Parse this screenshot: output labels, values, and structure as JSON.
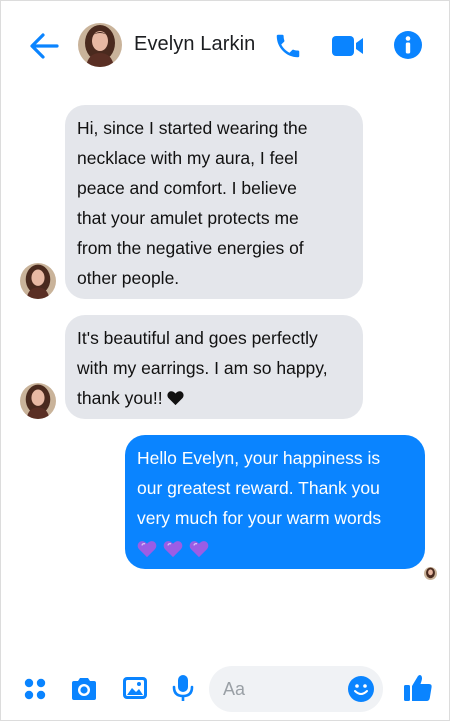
{
  "header": {
    "contact_name": "Evelyn Larkin",
    "icons": {
      "back": "arrow-left-icon",
      "call": "phone-icon",
      "video": "video-camera-icon",
      "info": "info-icon"
    }
  },
  "conversation": {
    "messages": [
      {
        "direction": "incoming",
        "lines": [
          "Hi, since I started wearing the",
          "necklace with my aura, I feel",
          "peace and comfort. I believe",
          "that your amulet protects me",
          "from the negative energies of",
          "other people."
        ]
      },
      {
        "direction": "incoming",
        "lines": [
          "It's beautiful and goes perfectly",
          "with my earrings. I am so happy,",
          "thank you!!"
        ],
        "trailing_emoji": "black-heart-icon"
      },
      {
        "direction": "outgoing",
        "lines": [
          "Hello Evelyn, your happiness is",
          "our greatest reward. Thank you",
          "very much for your warm words"
        ],
        "trailing_emoji": [
          "purple-heart-icon",
          "purple-heart-icon",
          "purple-heart-icon"
        ]
      }
    ]
  },
  "composer": {
    "placeholder": "Aa",
    "icons": [
      "apps-icon",
      "camera-icon",
      "photo-icon",
      "microphone-icon",
      "emoji-icon",
      "thumbs-up-icon"
    ]
  },
  "colors": {
    "accent": "#0a84ff",
    "incoming_bubble": "#e4e6eb",
    "outgoing_bubble": "#0a84ff",
    "purple_heart": "#9b5de5"
  }
}
